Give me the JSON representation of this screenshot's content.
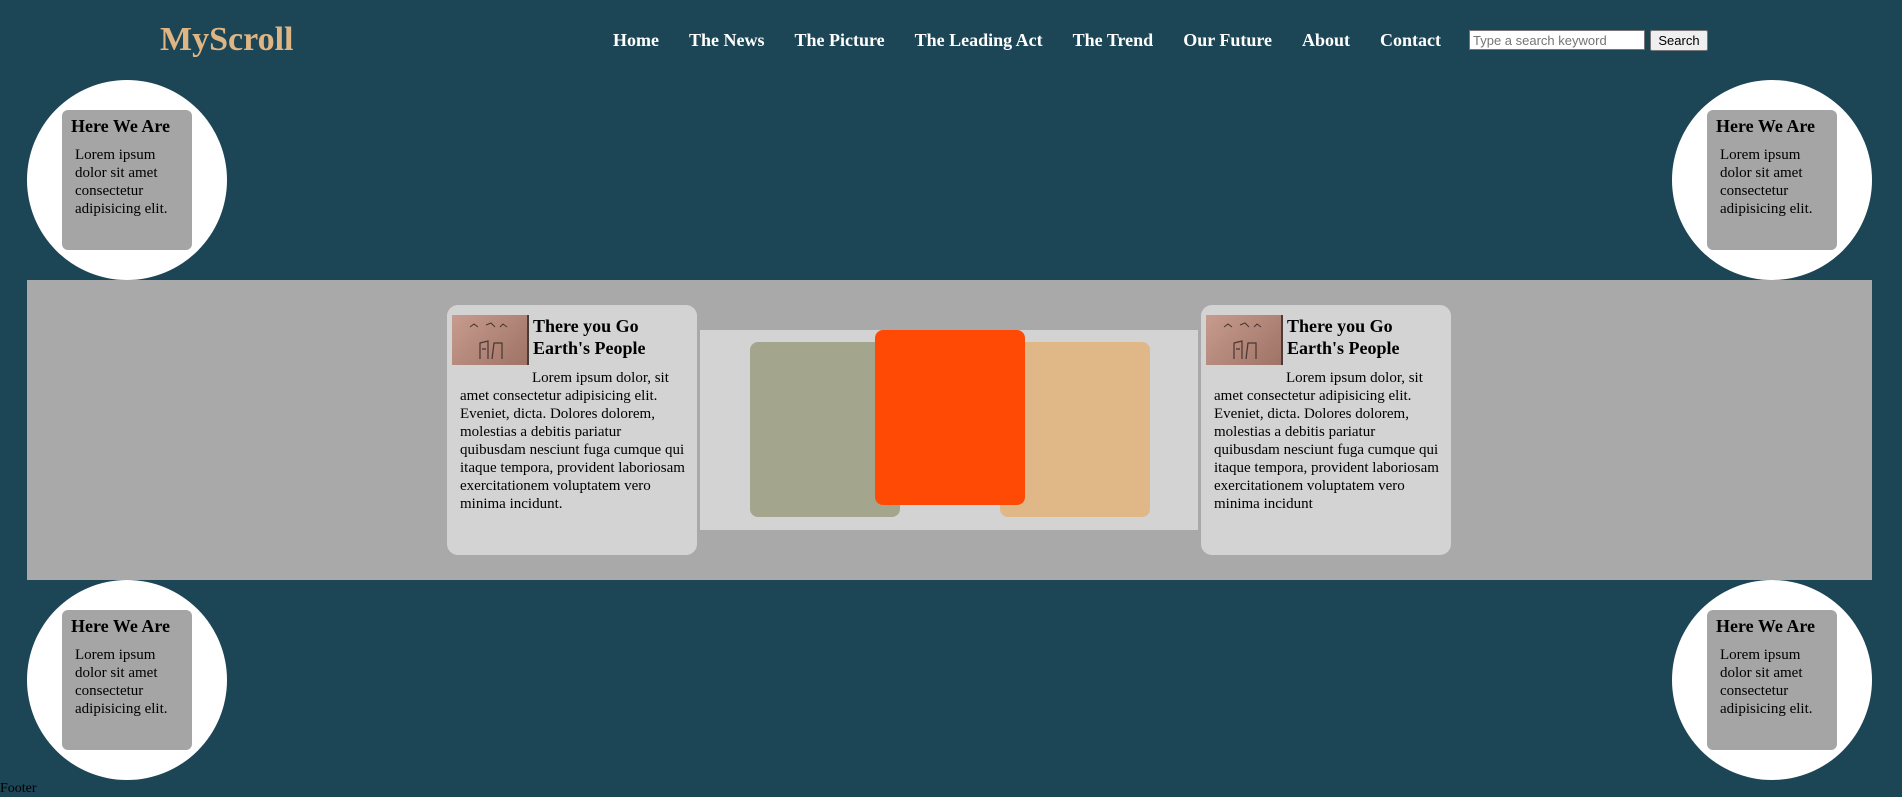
{
  "brand": {
    "logo": "MyScroll"
  },
  "nav": {
    "items": [
      "Home",
      "The News",
      "The Picture",
      "The Leading Act",
      "The Trend",
      "Our Future",
      "About",
      "Contact"
    ]
  },
  "search": {
    "placeholder": "Type a search keyword",
    "value": "",
    "button_label": "Search"
  },
  "corner_cards": [
    {
      "title": "Here We Are",
      "body": "Lorem ipsum dolor sit amet consectetur adipisicing elit."
    },
    {
      "title": "Here We Are",
      "body": "Lorem ipsum dolor sit amet consectetur adipisicing elit."
    },
    {
      "title": "Here We Are",
      "body": "Lorem ipsum dolor sit amet consectetur adipisicing elit."
    },
    {
      "title": "Here We Are",
      "body": "Lorem ipsum dolor sit amet consectetur adipisicing elit."
    }
  ],
  "stories": [
    {
      "title": "There you Go Earth's People",
      "body": "Lorem ipsum dolor, sit amet consectetur adipisicing elit. Eveniet, dicta. Dolores dolorem, molestias a debitis pariatur quibusdam nesciunt fuga cumque qui itaque tempora, provident laboriosam exercitationem voluptatem vero minima incidunt."
    },
    {
      "title": "There you Go Earth's People",
      "body": "Lorem ipsum dolor, sit amet consectetur adipisicing elit. Eveniet, dicta. Dolores dolorem, molestias a debitis pariatur quibusdam nesciunt fuga cumque qui itaque tempora, provident laboriosam exercitationem voluptatem vero minima incidunt"
    }
  ],
  "colors": {
    "page_bg": "#1c4555",
    "logo": "#dfb584",
    "band": "#a9a9a9",
    "card_gray": "#a5a5a5",
    "story_bg": "#d3d3d3",
    "slide_left": "#a4a58d",
    "slide_center": "#ff4a06",
    "slide_right": "#e0b888"
  },
  "footer": {
    "text": "Footer"
  }
}
